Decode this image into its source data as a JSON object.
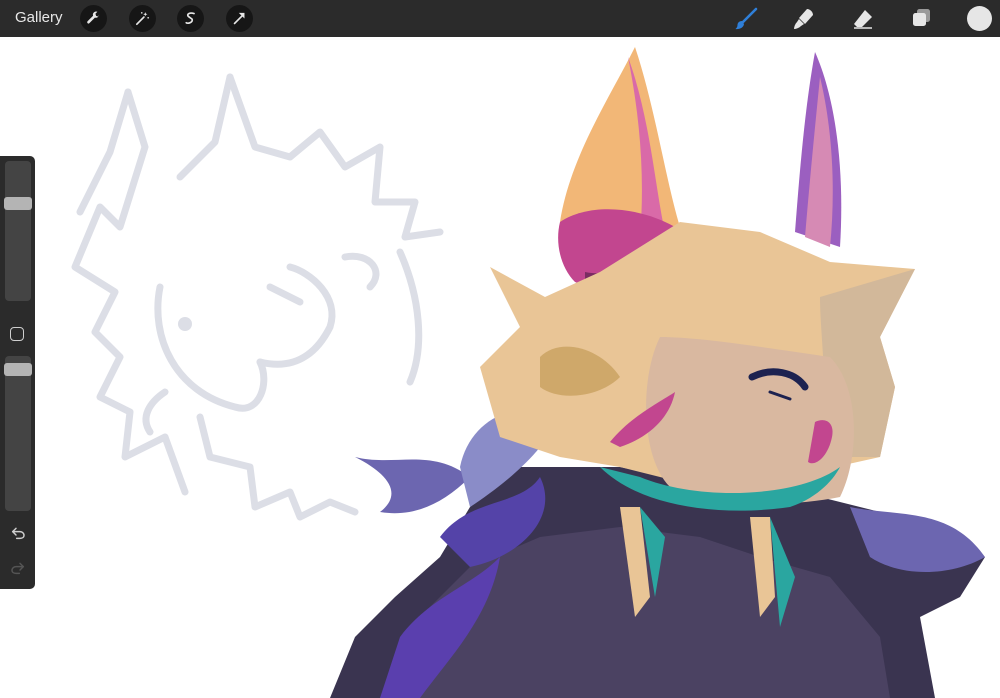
{
  "toolbar": {
    "gallery_label": "Gallery",
    "left_icons": [
      "wrench-icon",
      "magic-wand-icon",
      "selection-icon",
      "transform-arrow-icon"
    ],
    "right_icons": [
      "brush-icon",
      "smudge-icon",
      "eraser-icon",
      "layers-icon"
    ],
    "active_tool": "brush",
    "active_color": "#2f7fd8",
    "current_color": "#e6e6e6"
  },
  "sidebar": {
    "brush_size": 0.72,
    "opacity": 0.95,
    "icons": [
      "modify-square-icon",
      "undo-icon",
      "redo-icon"
    ]
  },
  "colors": {
    "bar": "#2b2b2b",
    "sketch": "#dcdee6",
    "skin": "#e9c596",
    "horn": "#f2b777",
    "horn_shadow": "#c2468f",
    "hair": "#4b3f9e",
    "teal": "#2aa6a0",
    "body": "#3a3450"
  }
}
